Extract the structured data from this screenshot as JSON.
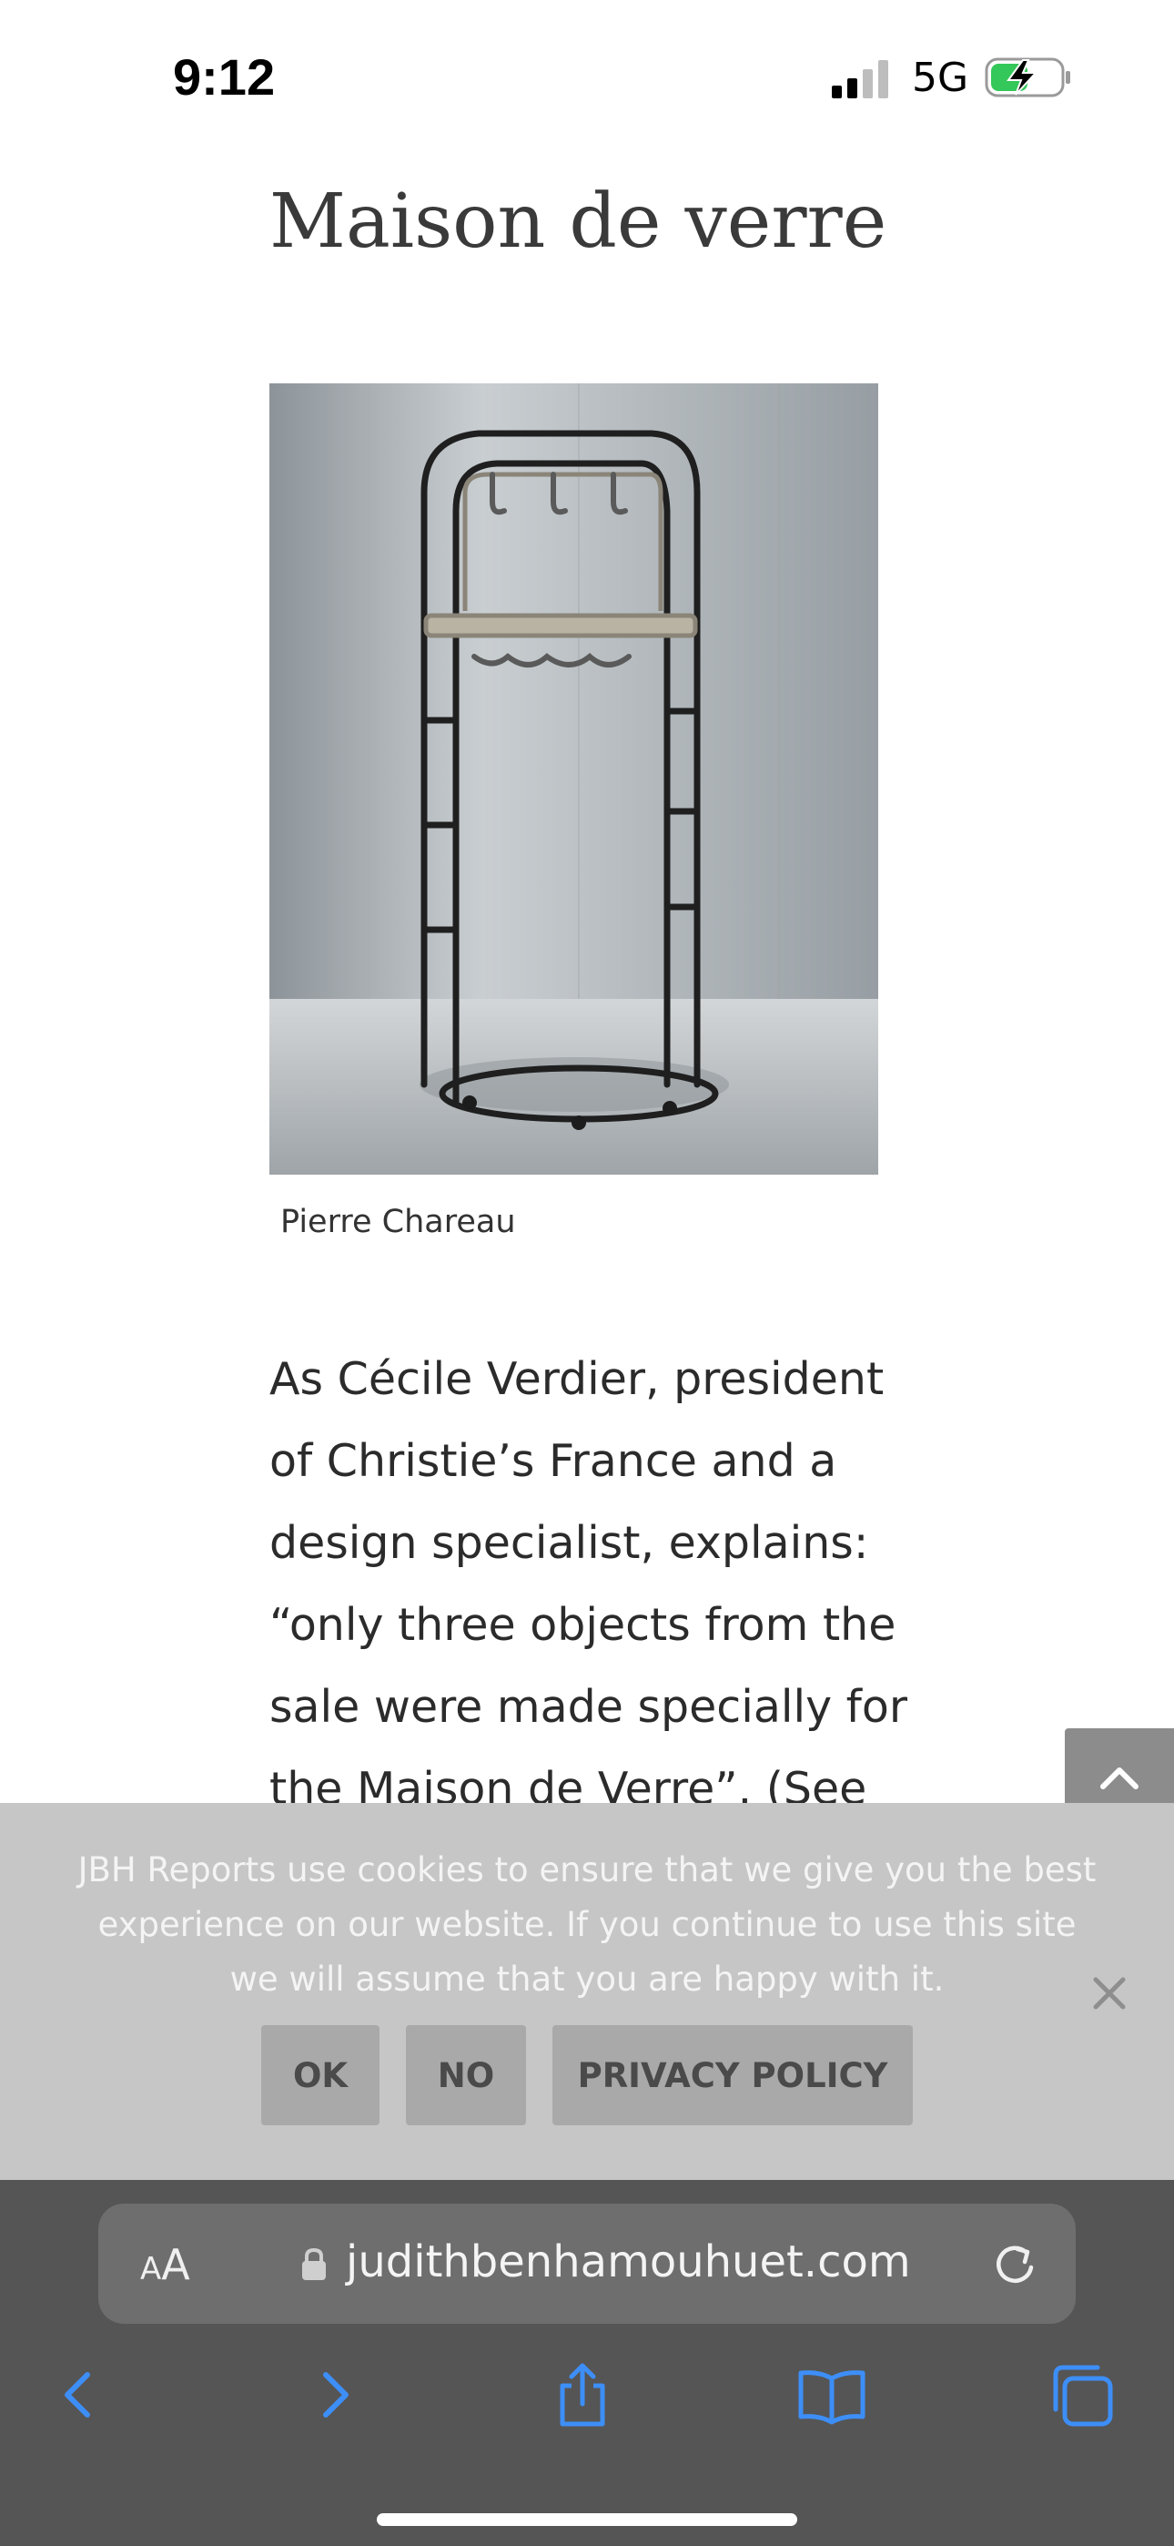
{
  "status_bar": {
    "time": "9:12",
    "network": "5G",
    "battery_state": "charging",
    "icons": [
      "signal-icon",
      "battery-charging-icon"
    ]
  },
  "article": {
    "title": "Maison de verre",
    "image": {
      "depicts": "tall black metal coat rack with hooks and tray",
      "icon": "photo"
    },
    "caption": "Pierre Chareau",
    "body": "As Cécile Verdier, president of Christie’s France and a design specialist, explains: “only three objects from the sale were made specially for the Maison de Verre”. (See"
  },
  "back_to_top": {
    "icon": "chevron-up-icon"
  },
  "cookie_banner": {
    "message": "JBH Reports use cookies to ensure that we give you the best experience on our website. If you continue to use this site we will assume that you are happy with it.",
    "ok_label": "OK",
    "no_label": "NO",
    "privacy_label": "PRIVACY POLICY",
    "close_icon": "close-icon"
  },
  "safari": {
    "aa_small": "A",
    "aa_large": "A",
    "url": "judithbenhamouhuet.com",
    "toolbar_icons": [
      "back-icon",
      "forward-icon",
      "share-icon",
      "bookmarks-icon",
      "tabs-icon"
    ],
    "accent_color": "#3d8ef7"
  },
  "colors": {
    "cookie_bg": "#c6c6c6",
    "cookie_button": "#a9a9a9",
    "safari_bg": "#555555",
    "title_text": "#3a3a3a"
  }
}
